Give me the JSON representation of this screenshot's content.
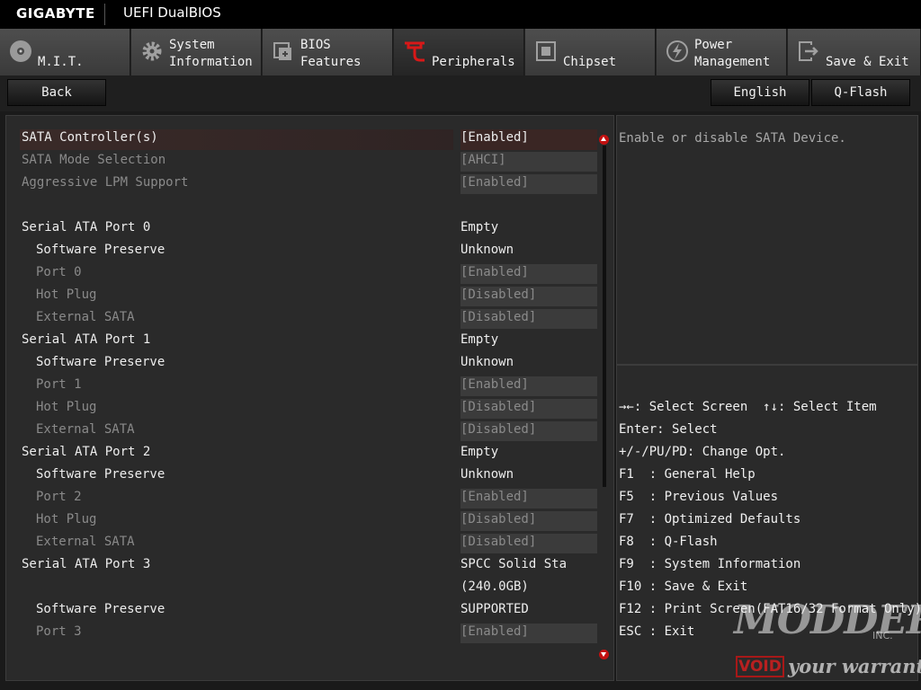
{
  "header": {
    "logo": "GIGABYTE",
    "title": "UEFI DualBIOS"
  },
  "tabs": [
    {
      "line1": "",
      "line2": "M.I.T.",
      "icon": "disc-icon"
    },
    {
      "line1": "System",
      "line2": "Information",
      "icon": "gear-icon"
    },
    {
      "line1": "BIOS",
      "line2": "Features",
      "icon": "bios-chip-icon"
    },
    {
      "line1": "",
      "line2": "Peripherals",
      "icon": "peripherals-plug-icon"
    },
    {
      "line1": "",
      "line2": "Chipset",
      "icon": "chip-icon"
    },
    {
      "line1": "Power",
      "line2": "Management",
      "icon": "power-icon"
    },
    {
      "line1": "",
      "line2": "Save & Exit",
      "icon": "exit-icon"
    }
  ],
  "toolbar": {
    "back": "Back",
    "language": "English",
    "qflash": "Q-Flash"
  },
  "settings": [
    {
      "label": "SATA Controller(s)",
      "value": "[Enabled]"
    },
    {
      "label": "SATA Mode Selection",
      "value": "[AHCI]"
    },
    {
      "label": "Aggressive LPM Support",
      "value": "[Enabled]"
    },
    {
      "label": "Serial ATA Port 0",
      "value": "Empty"
    },
    {
      "label": "Software Preserve",
      "value": "Unknown"
    },
    {
      "label": "Port 0",
      "value": "[Enabled]"
    },
    {
      "label": "Hot Plug",
      "value": "[Disabled]"
    },
    {
      "label": "External SATA",
      "value": "[Disabled]"
    },
    {
      "label": "Serial ATA Port 1",
      "value": "Empty"
    },
    {
      "label": "Software Preserve",
      "value": "Unknown"
    },
    {
      "label": "Port 1",
      "value": "[Enabled]"
    },
    {
      "label": "Hot Plug",
      "value": "[Disabled]"
    },
    {
      "label": "External SATA",
      "value": "[Disabled]"
    },
    {
      "label": "Serial ATA Port 2",
      "value": "Empty"
    },
    {
      "label": "Software Preserve",
      "value": "Unknown"
    },
    {
      "label": "Port 2",
      "value": "[Enabled]"
    },
    {
      "label": "Hot Plug",
      "value": "[Disabled]"
    },
    {
      "label": "External SATA",
      "value": "[Disabled]"
    },
    {
      "label": "Serial ATA Port 3",
      "value": "SPCC Solid Sta"
    },
    {
      "label": "",
      "value": "(240.0GB)"
    },
    {
      "label": "Software Preserve",
      "value": "SUPPORTED"
    },
    {
      "label": "Port 3",
      "value": "[Enabled]"
    }
  ],
  "help": {
    "text": "Enable or disable SATA Device."
  },
  "keys": [
    "→←: Select Screen  ↑↓: Select Item",
    "Enter: Select",
    "+/-/PU/PD: Change Opt.",
    "F1  : General Help",
    "F5  : Previous Values",
    "F7  : Optimized Defaults",
    "F8  : Q-Flash",
    "F9  : System Information",
    "F10 : Save & Exit",
    "F12 : Print Screen(FAT16/32 Format Only)",
    "ESC : Exit"
  ],
  "watermark": {
    "name": "MODDERS",
    "inc": "INC.",
    "void": "VOID",
    "tagline": "your warranty"
  },
  "colors": {
    "selection": "#3a2624",
    "scroll_arrow": "#c21010",
    "peripherals_icon": "#d81818"
  }
}
